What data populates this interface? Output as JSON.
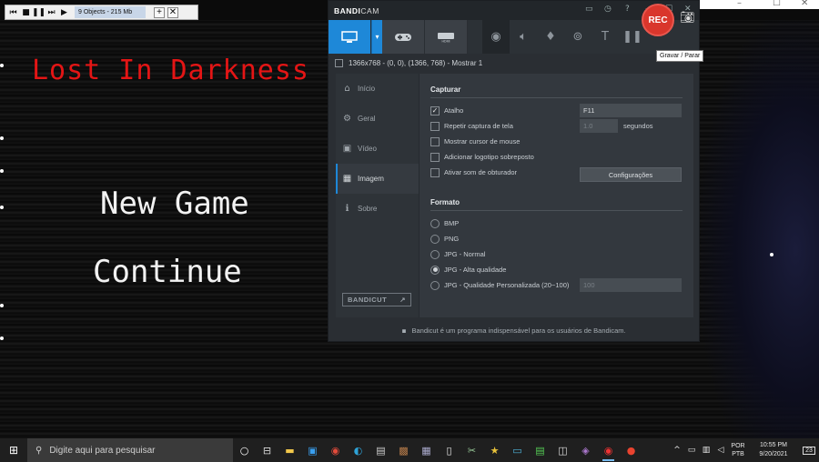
{
  "game": {
    "title": "Lost In Darkness",
    "menu": [
      "New Game",
      "Continue"
    ]
  },
  "mini_toolbar": {
    "objects_label": "9 Objects - 215 Mb",
    "plus": "+",
    "close": "✕"
  },
  "bandicam": {
    "logo_main": "BANDI",
    "logo_sub": "CAM",
    "rec_label": "REC",
    "tooltip": "Gravar / Parar",
    "area_text": "1366x768 - (0, 0), (1366, 768) - Mostrar 1",
    "sidebar": [
      {
        "label": "Início",
        "icon": "home-icon",
        "glyph": "⌂"
      },
      {
        "label": "Geral",
        "icon": "gear-icon",
        "glyph": "⚙"
      },
      {
        "label": "Vídeo",
        "icon": "video-icon",
        "glyph": "▣"
      },
      {
        "label": "Imagem",
        "icon": "image-icon",
        "glyph": "▦"
      },
      {
        "label": "Sobre",
        "icon": "info-icon",
        "glyph": "ℹ"
      }
    ],
    "active_sidebar": "Imagem",
    "bandicut_label": "BANDICUT",
    "bandicut_arrow": "↗",
    "capture": {
      "title": "Capturar",
      "hotkey_label": "Atalho",
      "hotkey_value": "F11",
      "repeat_label": "Repetir captura de tela",
      "repeat_value": "1.0",
      "repeat_unit": "segundos",
      "cursor_label": "Mostrar cursor de mouse",
      "logo_label": "Adicionar logotipo sobreposto",
      "shutter_label": "Ativar som de obturador",
      "settings_button": "Configurações"
    },
    "format": {
      "title": "Formato",
      "options": [
        "BMP",
        "PNG",
        "JPG - Normal",
        "JPG - Alta qualidade",
        "JPG - Qualidade Personalizada (20~100)"
      ],
      "selected": "JPG - Alta qualidade",
      "quality_value": "100"
    },
    "footer": "Bandicut é um programa indispensável para os usuários de Bandicam."
  },
  "taskbar": {
    "search_placeholder": "Digite aqui para pesquisar",
    "lang_top": "POR",
    "lang_bottom": "PTB",
    "time": "10:55 PM",
    "date": "9/20/2021",
    "notif_count": "23"
  }
}
